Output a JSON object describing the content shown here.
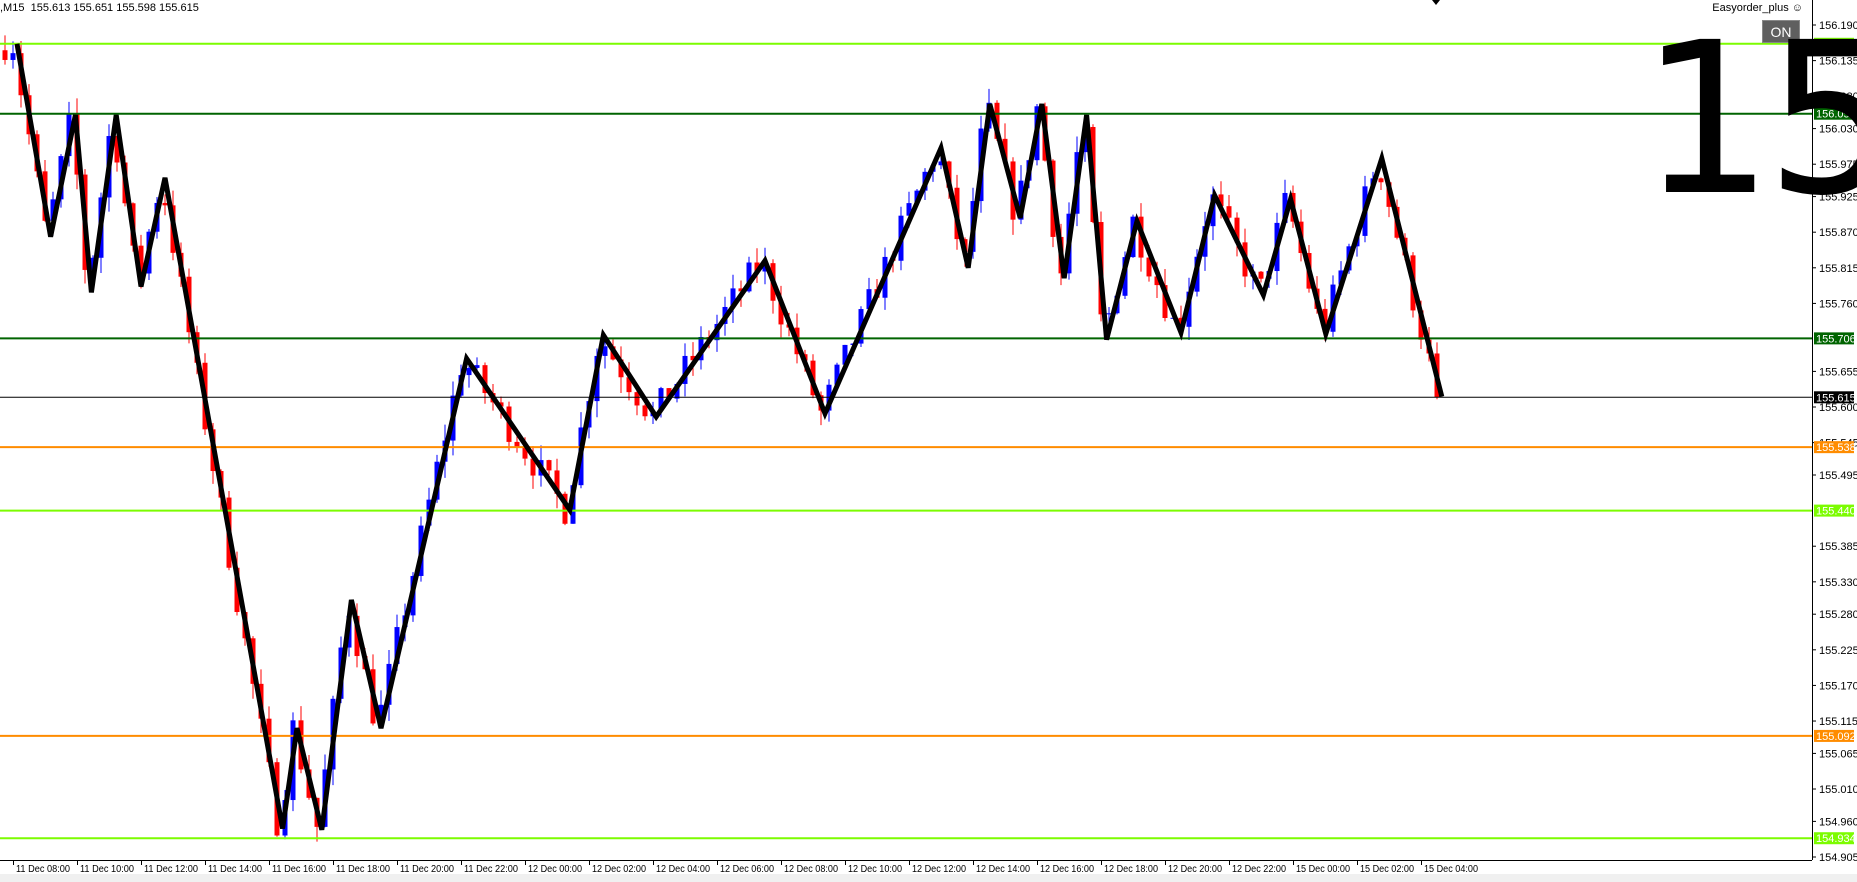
{
  "header": {
    "symbol_timeframe": ",M15",
    "ohlc": "155.613 155.651 155.598 155.615"
  },
  "expert": {
    "name": "Easyorder_plus",
    "smiley_icon": "smiley-icon",
    "on_button": "ON"
  },
  "overlay_text": "15",
  "colors": {
    "bull": "#0000ff",
    "bear": "#ff0000",
    "lime": "#7cfc00",
    "dark_green": "#006400",
    "orange": "#ff8c00",
    "black": "#000000"
  },
  "chart_data": {
    "type": "candlestick",
    "timeframe": "M15",
    "ylim": [
      154.905,
      156.19
    ],
    "price_ticks": [
      "156.190",
      "156.135",
      "156.080",
      "156.030",
      "155.975",
      "155.925",
      "155.870",
      "155.815",
      "155.760",
      "155.655",
      "155.600",
      "155.545",
      "155.495",
      "155.385",
      "155.330",
      "155.280",
      "155.225",
      "155.170",
      "155.115",
      "155.065",
      "155.010",
      "154.960",
      "154.905"
    ],
    "time_ticks": [
      "11 Dec 08:00",
      "11 Dec 10:00",
      "11 Dec 12:00",
      "11 Dec 14:00",
      "11 Dec 16:00",
      "11 Dec 18:00",
      "11 Dec 20:00",
      "11 Dec 22:00",
      "12 Dec 00:00",
      "12 Dec 02:00",
      "12 Dec 04:00",
      "12 Dec 06:00",
      "12 Dec 08:00",
      "12 Dec 10:00",
      "12 Dec 12:00",
      "12 Dec 14:00",
      "12 Dec 16:00",
      "12 Dec 18:00",
      "12 Dec 20:00",
      "12 Dec 22:00",
      "15 Dec 00:00",
      "15 Dec 02:00",
      "15 Dec 04:00"
    ],
    "levels": [
      {
        "price": "156.161",
        "color": "lime"
      },
      {
        "price": "156.053",
        "color": "dark_green"
      },
      {
        "price": "155.706",
        "color": "dark_green"
      },
      {
        "price": "155.615",
        "color": "black"
      },
      {
        "price": "155.538",
        "color": "orange"
      },
      {
        "price": "155.440",
        "color": "lime"
      },
      {
        "price": "155.092",
        "color": "orange"
      },
      {
        "price": "154.934",
        "color": "lime"
      }
    ],
    "zigzag": {
      "bars": [
        0.5,
        4.7,
        7.8,
        9.8,
        12.9,
        16,
        19,
        33.7,
        35.5,
        38.6,
        42.3,
        46,
        56.7,
        69.6,
        73.8,
        80.4,
        94,
        101.5,
        116,
        119.4,
        122.1,
        125.9,
        128.6,
        131.4,
        134.2,
        136.7,
        140.5,
        146,
        150.2,
        156.3,
        159.7,
        164.1,
        171.1,
        178.6
      ],
      "prices": [
        156.161,
        155.863,
        156.051,
        155.777,
        156.051,
        155.786,
        155.954,
        154.949,
        155.104,
        154.947,
        155.302,
        155.104,
        155.675,
        155.441,
        155.711,
        155.585,
        155.826,
        155.59,
        156.0,
        155.815,
        156.068,
        155.892,
        156.068,
        155.799,
        156.051,
        155.704,
        155.887,
        155.715,
        155.927,
        155.773,
        155.921,
        155.713,
        155.984,
        155.616
      ]
    }
  }
}
